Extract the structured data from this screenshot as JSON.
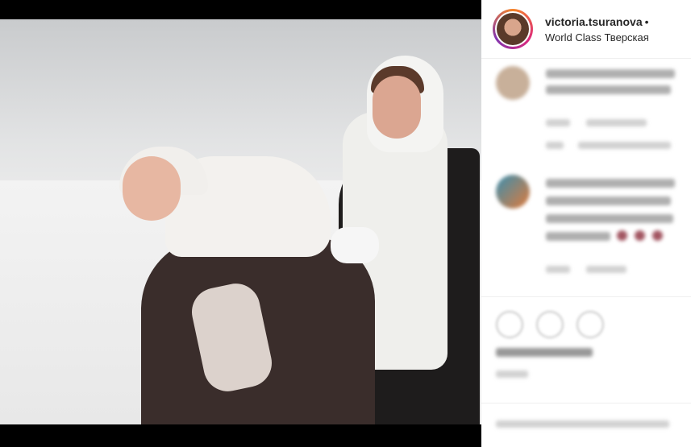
{
  "post": {
    "username": "victoria.tsuranova",
    "separator": "•",
    "location": "World Class Тверская"
  },
  "icons": [
    "heart-icon",
    "comment-icon",
    "share-icon"
  ]
}
